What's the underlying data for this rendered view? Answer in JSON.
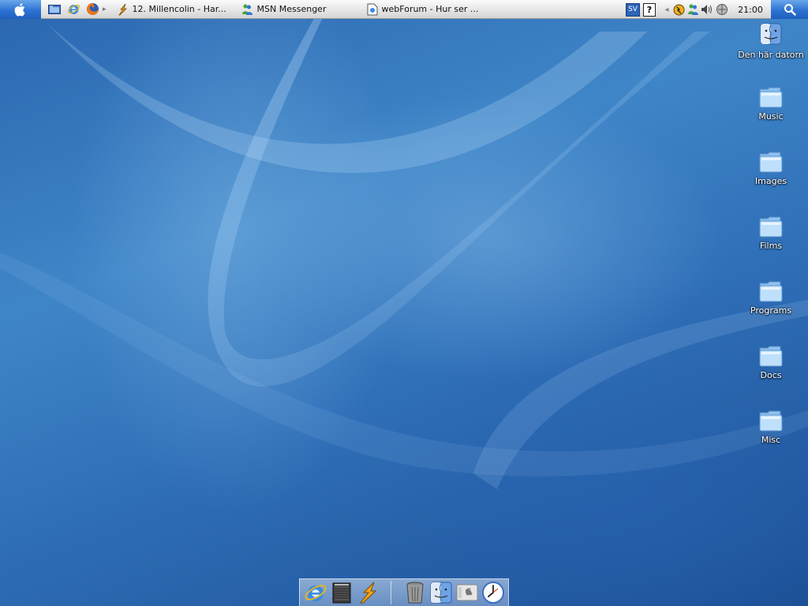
{
  "panel": {
    "quick_launch": [
      {
        "icon": "show-desktop-icon"
      },
      {
        "icon": "internet-explorer-icon"
      },
      {
        "icon": "firefox-icon"
      }
    ],
    "tasks": [
      {
        "icon": "winamp-icon",
        "label": "12. Millencolin - Har..."
      },
      {
        "icon": "msn-messenger-icon",
        "label": "MSN Messenger"
      },
      {
        "icon": "document-icon",
        "label": "webForum - Hur ser ..."
      }
    ],
    "tray": {
      "language": "SV",
      "help": "?",
      "clock": "21:00"
    }
  },
  "desktop": {
    "icons": [
      {
        "label": "Den här datorn",
        "icon": "finder-computer-icon"
      },
      {
        "label": "Music",
        "icon": "folder-icon"
      },
      {
        "label": "Images",
        "icon": "folder-icon"
      },
      {
        "label": "Films",
        "icon": "folder-icon"
      },
      {
        "label": "Programs",
        "icon": "folder-icon"
      },
      {
        "label": "Docs",
        "icon": "folder-icon"
      },
      {
        "label": "Misc",
        "icon": "folder-icon"
      }
    ]
  },
  "dock": {
    "items": [
      "internet-explorer-icon",
      "amplifier-icon",
      "winamp-icon",
      "trash-icon",
      "finder-icon",
      "system-apple-icon",
      "clock-icon"
    ]
  },
  "colors": {
    "accent": "#2e72d2",
    "desktop": "#2f6fb8"
  }
}
